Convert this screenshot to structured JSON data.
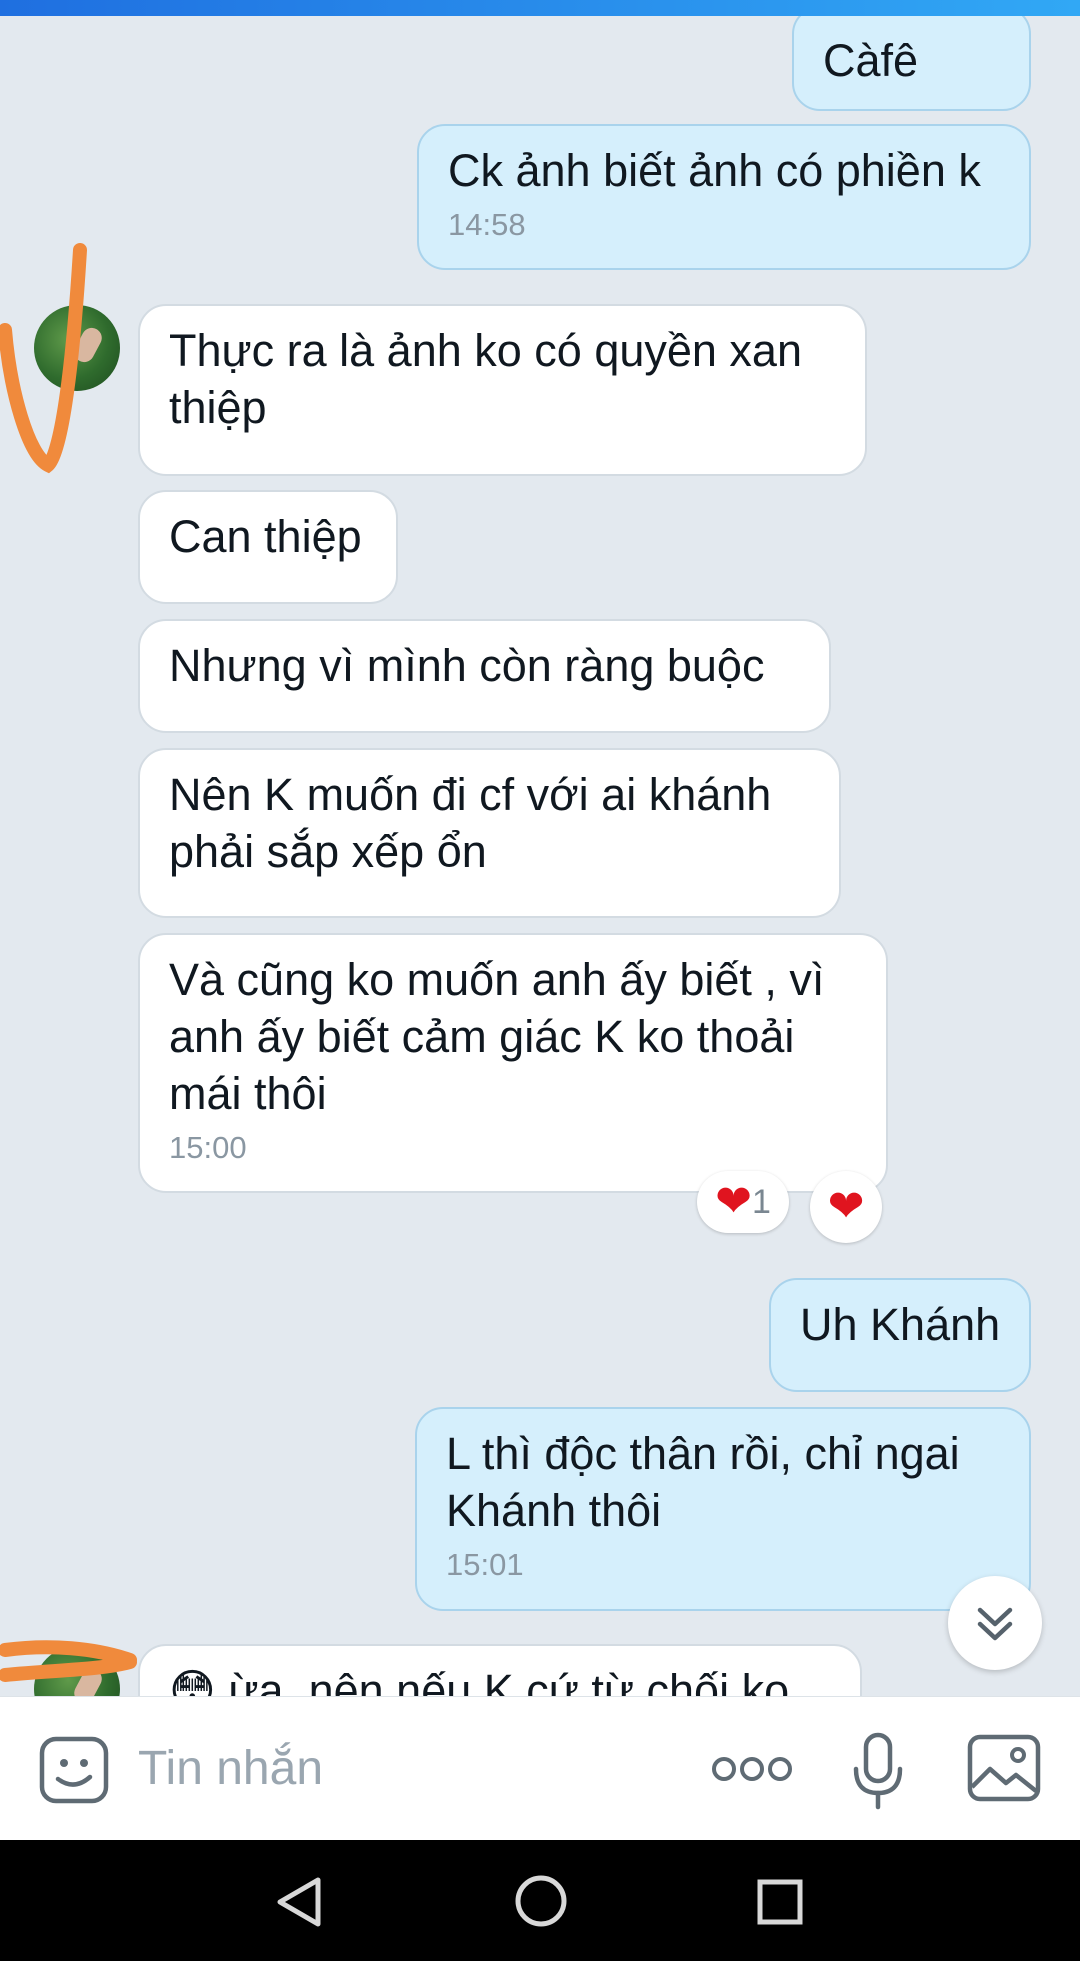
{
  "messages": [
    {
      "text": "Càfê"
    },
    {
      "text": "Ck ảnh biết ảnh có phiền k",
      "time": "14:58"
    },
    {
      "text": "Thực ra là ảnh ko có quyền xan thiệp"
    },
    {
      "text": "Can thiệp"
    },
    {
      "text": "Nhưng vì mình còn ràng buộc"
    },
    {
      "text": "Nên K muốn đi cf với ai khánh phải sắp xếp ổn"
    },
    {
      "text": "Và cũng ko muốn anh ấy biết , vì anh ấy biết cảm giác K ko thoải mái thôi",
      "time": "15:00",
      "reactions": {
        "heart_count": "1"
      }
    },
    {
      "text": "Uh Khánh"
    },
    {
      "text": "L thì độc thân rồi, chỉ ngai Khánh thôi",
      "time": "15:01"
    },
    {
      "text": "ừa, nên nếu K cứ từ chối ko"
    }
  ],
  "input": {
    "placeholder": "Tin nhắn"
  },
  "icons": {
    "sticker": "sticker-face-icon",
    "more": "more-dots-icon",
    "mic": "microphone-icon",
    "image": "image-icon",
    "scroll": "chevron-double-down-icon",
    "nav_back": "nav-back-icon",
    "nav_home": "nav-home-icon",
    "nav_recent": "nav-recent-icon"
  },
  "colors": {
    "outgoing_bubble": "#d5effc",
    "incoming_bubble": "#ffffff",
    "background": "#e3e9ef",
    "annotation": "#f08a3c",
    "reaction_heart": "#e0141f"
  }
}
